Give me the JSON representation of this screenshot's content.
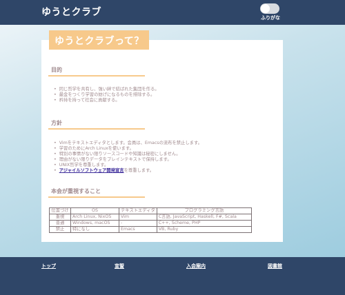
{
  "header": {
    "brand": "ゆうとクラブ",
    "toggle_label": "ふりがな"
  },
  "main": {
    "title": "ゆうとクラブって？",
    "sections": [
      {
        "heading": "目的",
        "items": [
          "同じ哲学を共有し、強い絆で結ばれた集団を作る。",
          "最金をつくり学習の妨げになるものを排除する。",
          "矜持を持って社会に貢献する。"
        ]
      },
      {
        "heading": "方針",
        "items": [
          "Vimをテキストエディタとします。会員は、Emacsの流布を禁止します。",
          "学習のためにArch Linuxを使います。",
          "特別の事情がない限りソースコードや知識は秘密にしません。",
          "理由がない限りデータをプレインテキストで保持します。",
          "UNIX哲学を尊重します。"
        ],
        "last_item_link": "アジャイルソフトウェア開発宣言",
        "last_item_suffix": "を尊重します。"
      },
      {
        "heading": "本会が重視すること"
      }
    ],
    "table": {
      "headers": [
        "位置づけ",
        "OS",
        "テキストエディタ",
        "プログラミング言語"
      ],
      "rows": [
        [
          "重視",
          "Arch Linux, NixOS",
          "Vim",
          "C言語, JavaScript, Haskell, F#, Scala"
        ],
        [
          "普通",
          "Windows, macOS",
          "-",
          "C++, Scheme, PHP"
        ],
        [
          "禁止",
          "特になし",
          "Emacs",
          "VB, Ruby"
        ]
      ]
    }
  },
  "footer": {
    "links": [
      "トップ",
      "宣誓",
      "入会案内",
      "図書館"
    ]
  },
  "colors": {
    "header_bg": "#2f4668",
    "accent": "#f7c98b",
    "text": "#a08a8e",
    "link": "#3b2a9a"
  }
}
